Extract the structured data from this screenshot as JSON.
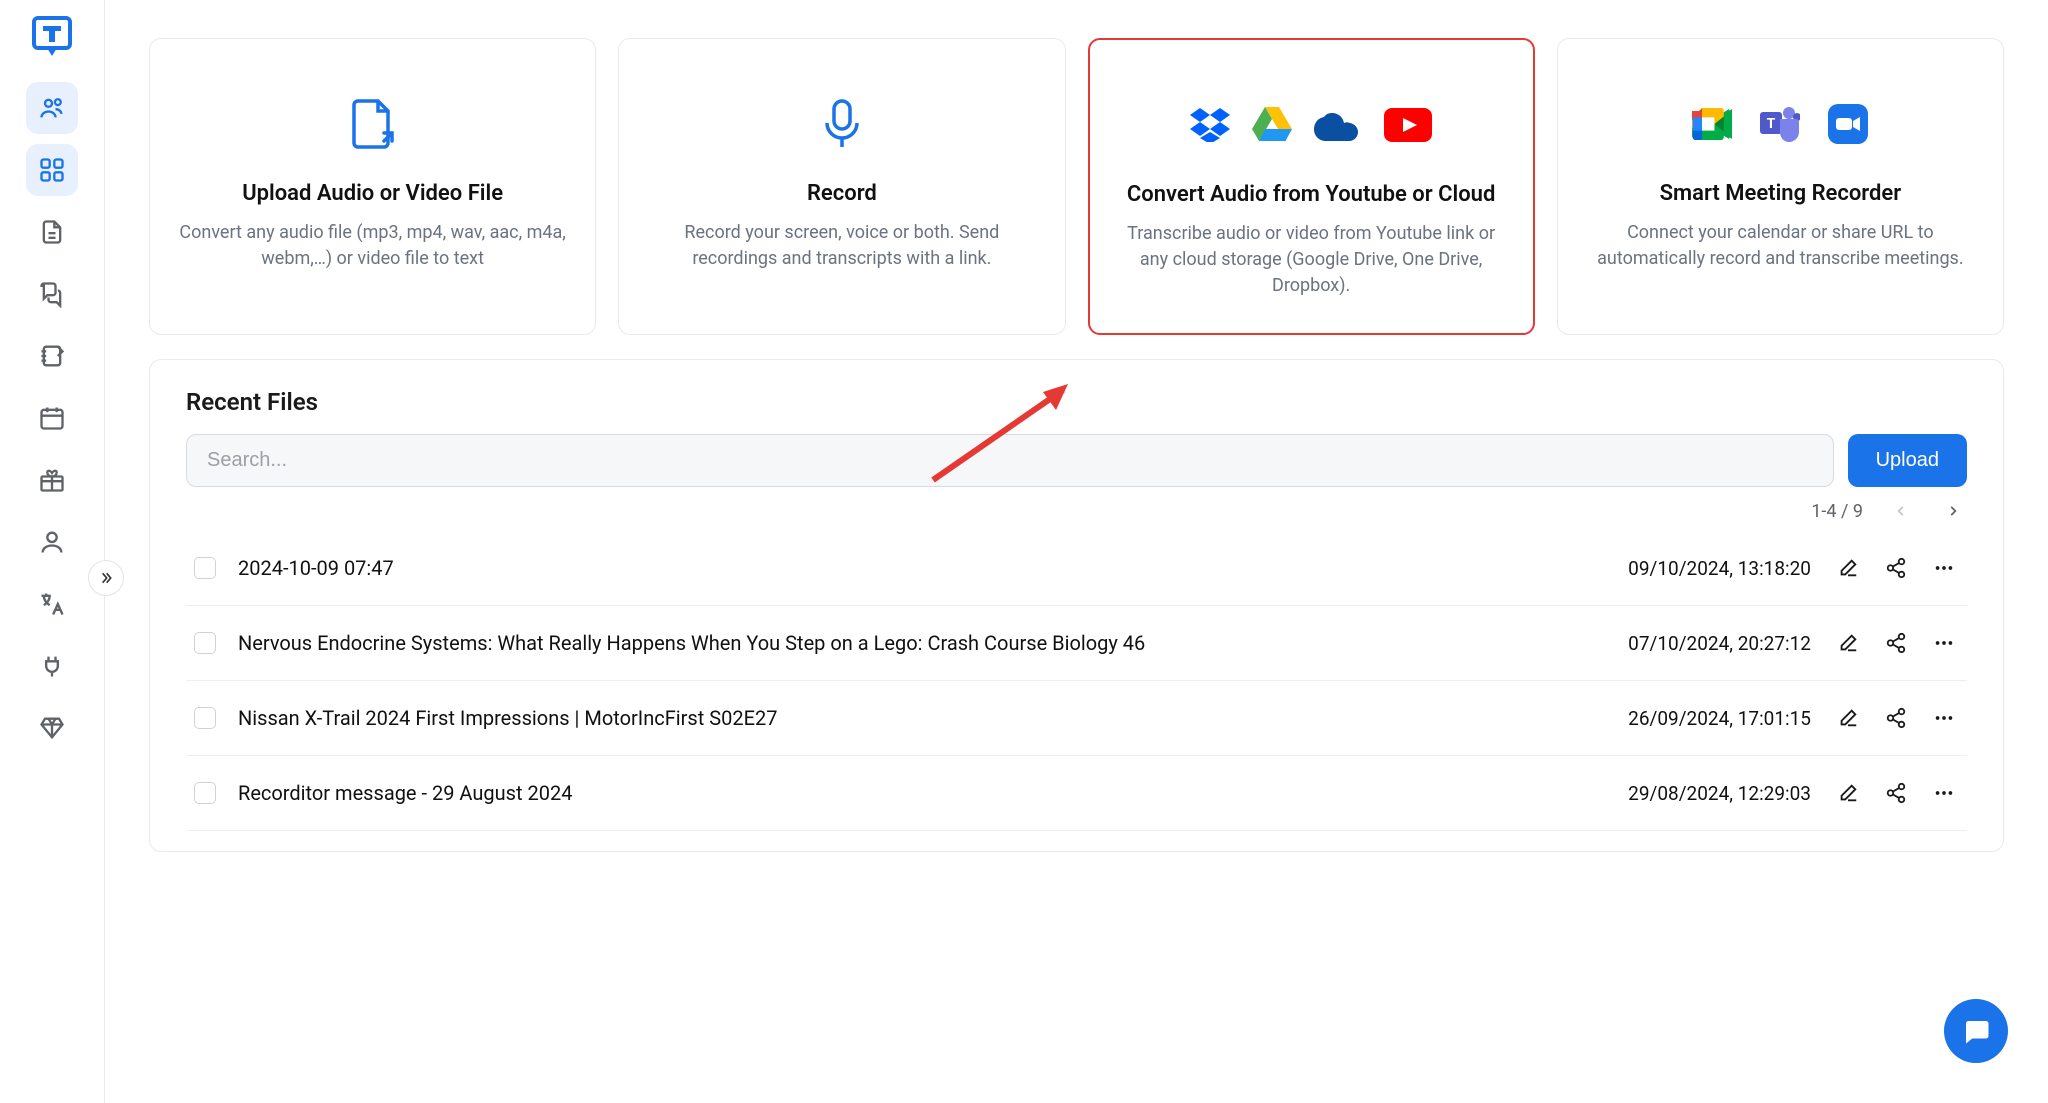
{
  "sidebar": {
    "items": [
      {
        "name": "logo"
      },
      {
        "name": "people-icon"
      },
      {
        "name": "dashboard-icon",
        "active": true
      },
      {
        "name": "document-icon"
      },
      {
        "name": "chat-icon"
      },
      {
        "name": "notebook-icon"
      },
      {
        "name": "calendar-icon"
      },
      {
        "name": "gift-icon"
      },
      {
        "name": "profile-icon"
      },
      {
        "name": "translate-icon"
      },
      {
        "name": "plug-icon"
      },
      {
        "name": "gem-icon"
      }
    ]
  },
  "cards": [
    {
      "title": "Upload Audio or Video File",
      "desc": "Convert any audio file (mp3, mp4, wav, aac, m4a, webm,…) or video file to text"
    },
    {
      "title": "Record",
      "desc": "Record your screen, voice or both. Send recordings and transcripts with a link."
    },
    {
      "title": "Convert Audio from Youtube or Cloud",
      "desc": "Transcribe audio or video from Youtube link or any cloud storage (Google Drive, One Drive, Dropbox)."
    },
    {
      "title": "Smart Meeting Recorder",
      "desc": "Connect your calendar or share URL to automatically record and transcribe meetings."
    }
  ],
  "recent": {
    "title": "Recent Files",
    "search_placeholder": "Search...",
    "upload_label": "Upload",
    "pager": "1-4 / 9",
    "files": [
      {
        "name": "2024-10-09 07:47",
        "date": "09/10/2024, 13:18:20"
      },
      {
        "name": "Nervous Endocrine Systems: What Really Happens When You Step on a Lego: Crash Course Biology 46",
        "date": "07/10/2024, 20:27:12"
      },
      {
        "name": "Nissan X-Trail 2024 First Impressions | MotorIncFirst S02E27",
        "date": "26/09/2024, 17:01:15"
      },
      {
        "name": "Recorditor message - 29 August 2024",
        "date": "29/08/2024, 12:29:03"
      }
    ]
  }
}
